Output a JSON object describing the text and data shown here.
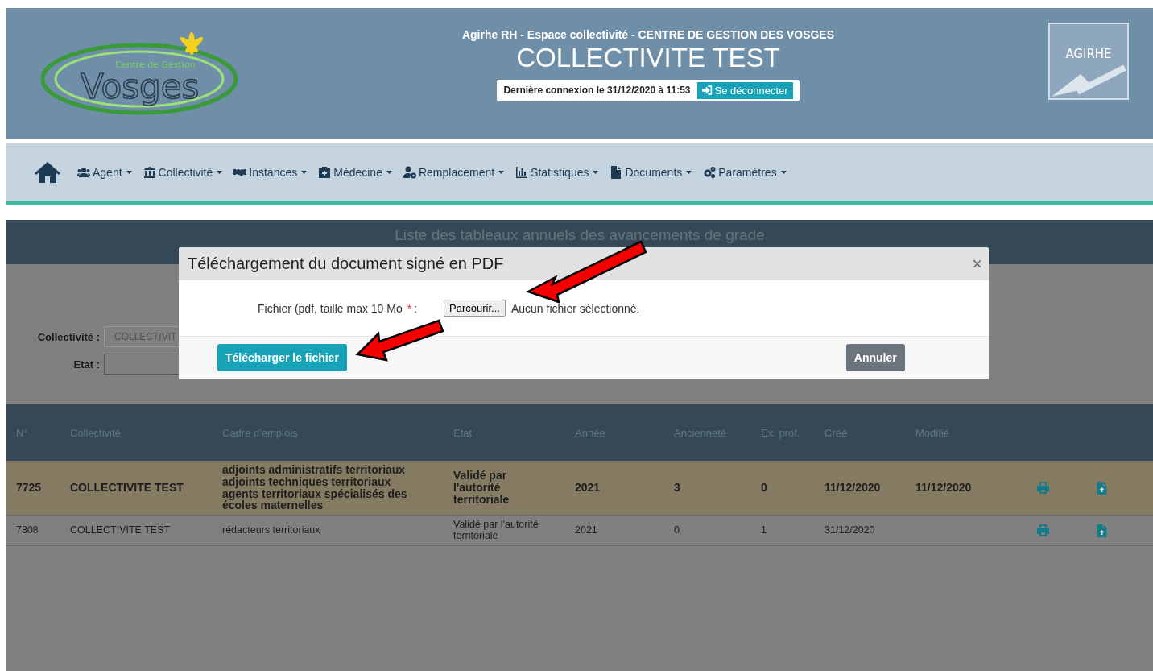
{
  "header": {
    "logo_left": {
      "line_1": "Centre de Gestion",
      "line_2": "Vosges"
    },
    "subtitle": "Agirhe RH - Espace collectivité - CENTRE DE GESTION DES VOSGES",
    "title": "COLLECTIVITE TEST",
    "last_login": "Dernière connexion le 31/12/2020 à 11:53",
    "logout_button": "Se déconnecter",
    "logo_right": "AGIRHE"
  },
  "nav": [
    {
      "label": "Agent"
    },
    {
      "label": "Collectivité"
    },
    {
      "label": "Instances"
    },
    {
      "label": "Médecine"
    },
    {
      "label": "Remplacement"
    },
    {
      "label": "Statistiques"
    },
    {
      "label": "Documents"
    },
    {
      "label": "Paramètres"
    }
  ],
  "page": {
    "title": "Liste des tableaux annuels des avancements de grade",
    "filters": [
      {
        "label": "Collectivité :",
        "value": "COLLECTIVIT"
      },
      {
        "label": "Etat :"
      }
    ],
    "table": {
      "columns": [
        "N°",
        "Collectivité",
        "Cadre d'emplois",
        "Etat",
        "Année",
        "Ancienneté",
        "Ex. prof.",
        "Créé",
        "Modifié"
      ],
      "rows": [
        {
          "selected": true,
          "cells": [
            "7725",
            "COLLECTIVITE TEST",
            [
              "adjoints administratifs territoriaux",
              "adjoints techniques territoriaux",
              "agents territoriaux spécialisés des écoles maternelles"
            ],
            "Validé par l'autorité territoriale",
            "2021",
            "3",
            "0",
            "11/12/2020",
            "11/12/2020"
          ]
        },
        {
          "selected": false,
          "cells": [
            "7808",
            "COLLECTIVITE TEST",
            [
              "rédacteurs territoriaux"
            ],
            "Validé par l'autorité territoriale",
            "2021",
            "0",
            "1",
            "31/12/2020",
            null
          ]
        }
      ]
    }
  },
  "modal": {
    "title": "Téléchargement du document signé en PDF",
    "close": "×",
    "field_label": "Fichier (pdf, taille max 10 Mo",
    "required_mark": "*",
    "label_colon": ":",
    "browse_button": "Parcourir...",
    "no_file": "Aucun fichier sélectionné.",
    "upload_button": "Télécharger le fichier",
    "cancel_button": "Annuler"
  }
}
